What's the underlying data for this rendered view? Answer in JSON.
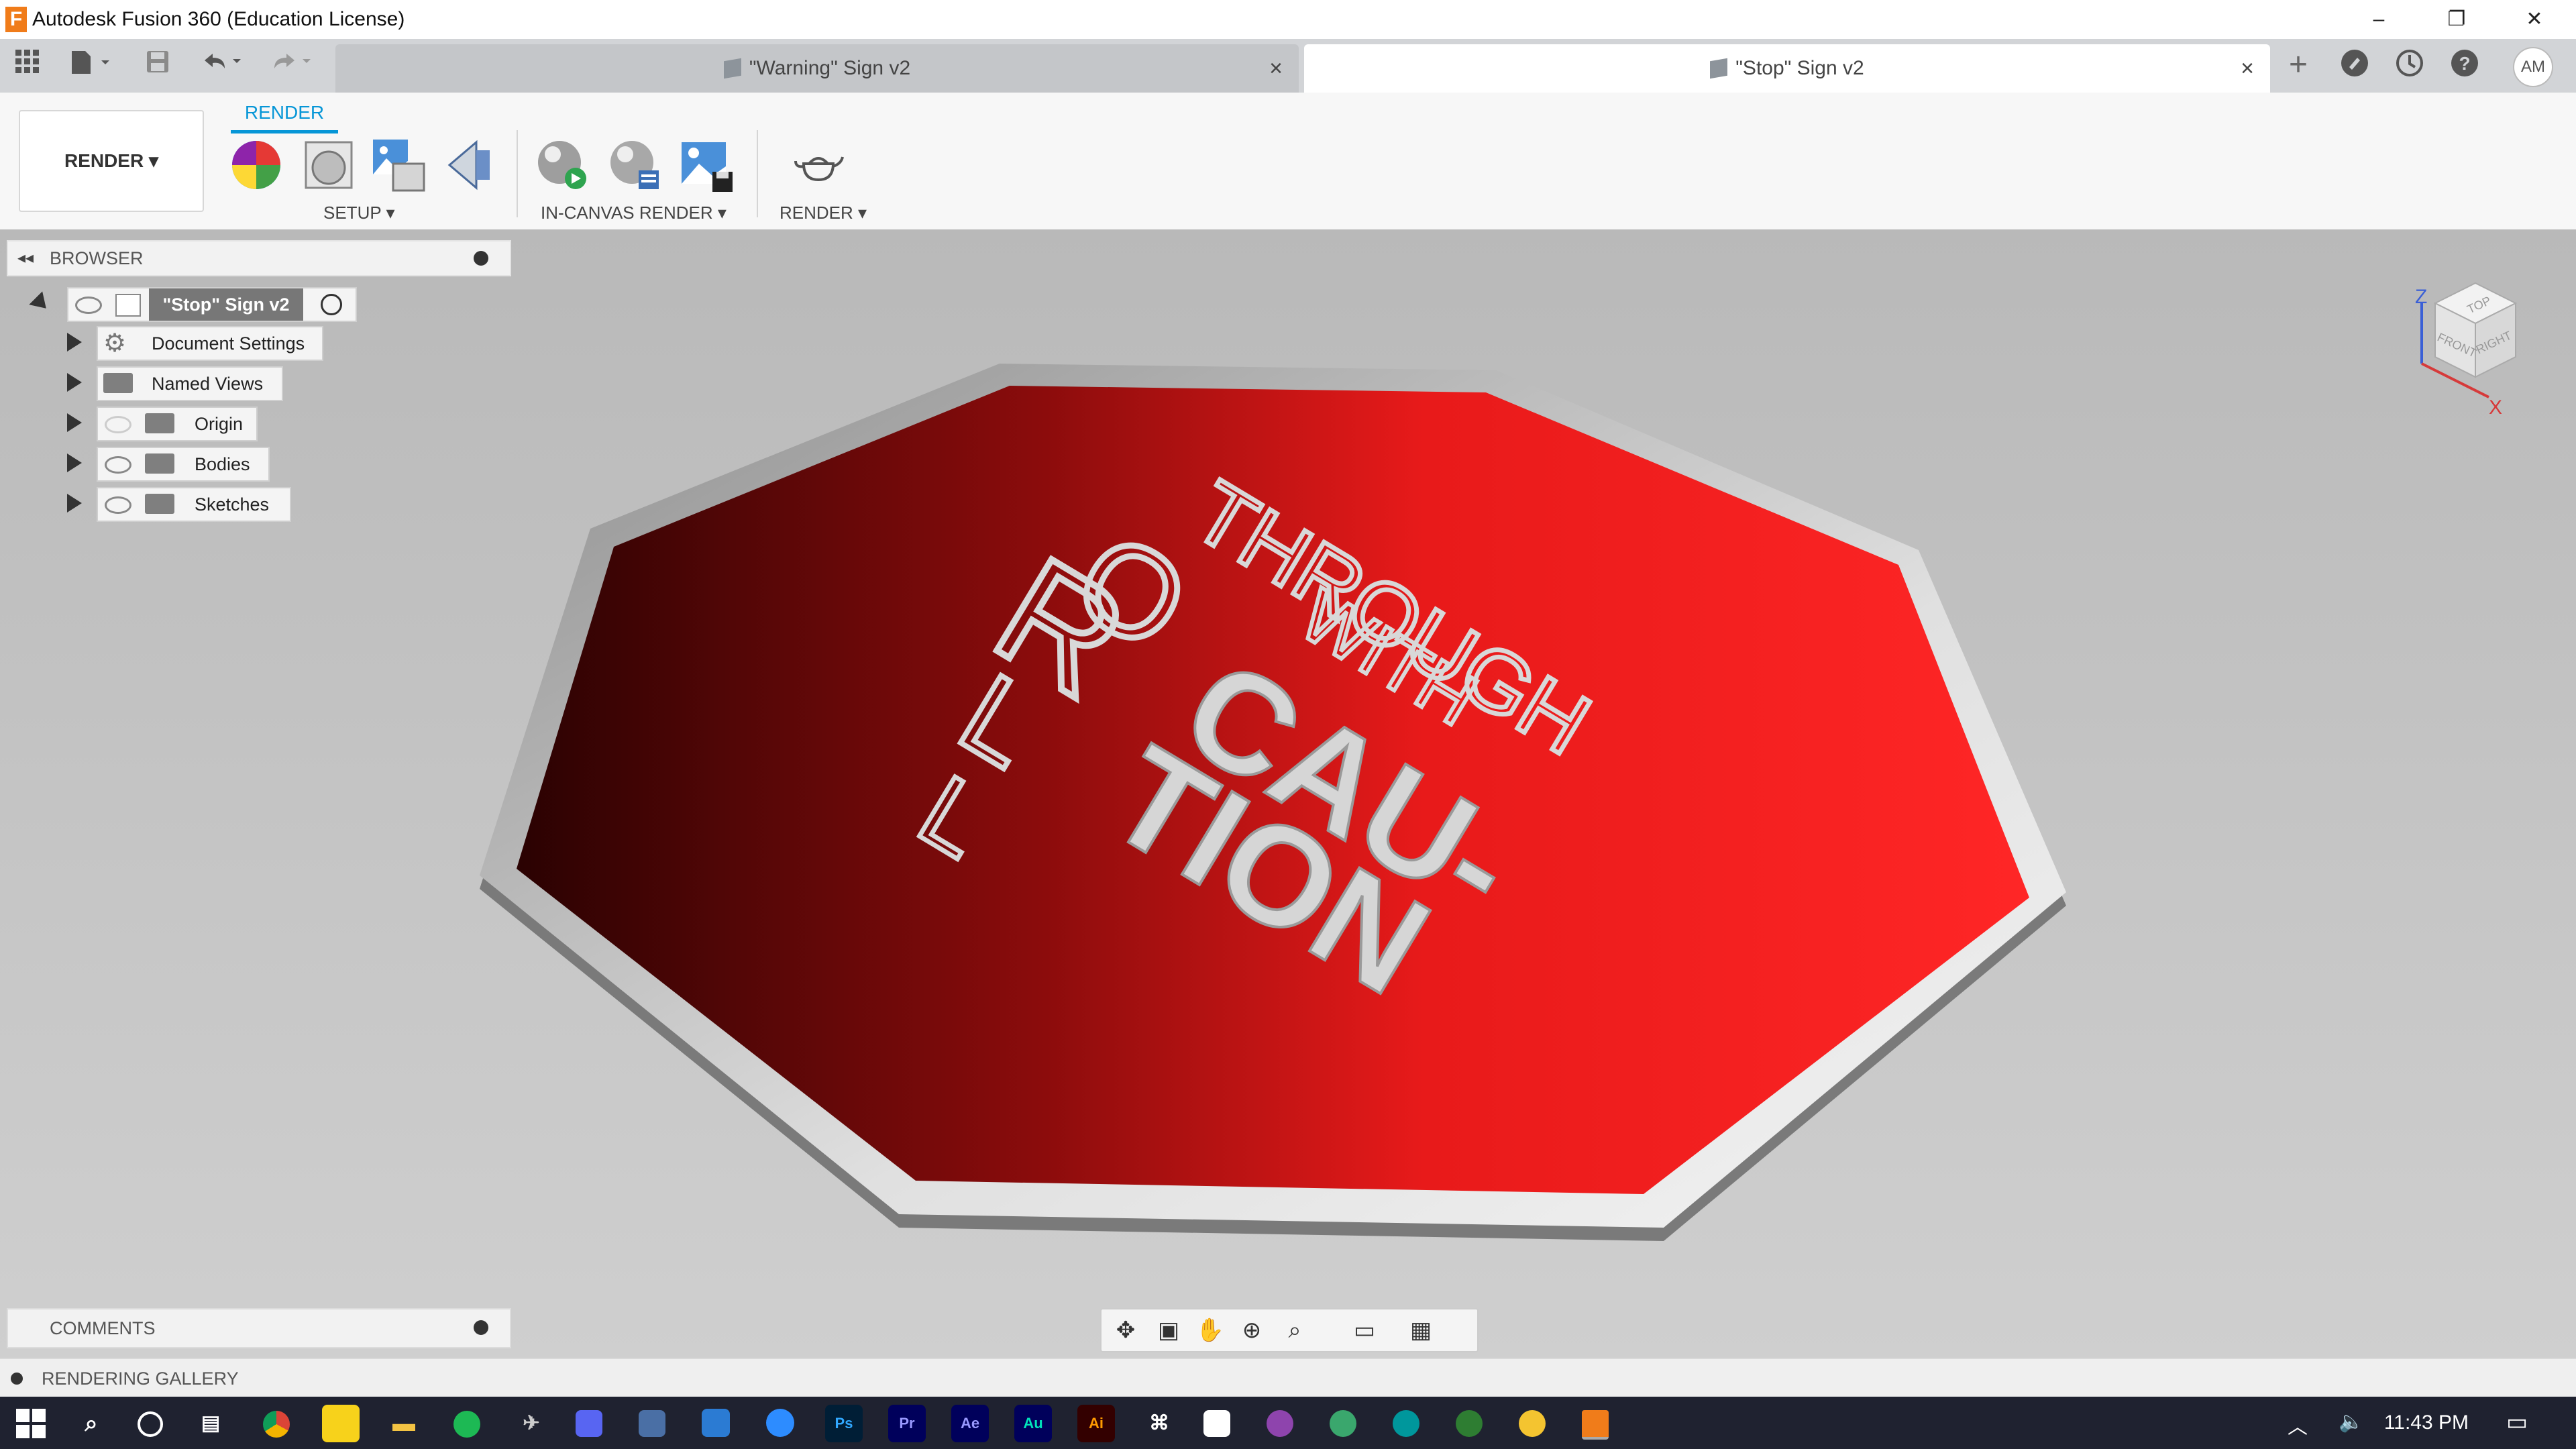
{
  "app": {
    "title": "Autodesk Fusion 360 (Education License)",
    "logo_letter": "F",
    "controls": {
      "minimize": "–",
      "restore": "❐",
      "close": "✕"
    }
  },
  "tabs": [
    {
      "label": "\"Warning\" Sign v2",
      "close": "×",
      "active": false
    },
    {
      "label": "\"Stop\" Sign v2",
      "close": "×",
      "active": true
    }
  ],
  "tabbar_right": {
    "new_tab": "+",
    "avatar": "AM"
  },
  "ribbon": {
    "workspace": "RENDER ▾",
    "active_tab": "RENDER",
    "groups": {
      "setup": "SETUP ▾",
      "in_canvas": "IN-CANVAS RENDER ▾",
      "render": "RENDER ▾"
    }
  },
  "browser": {
    "header": "BROWSER",
    "root": "\"Stop\" Sign v2",
    "items": [
      {
        "label": "Document Settings",
        "icon": "gear-icon"
      },
      {
        "label": "Named Views",
        "icon": "folder-icon"
      },
      {
        "label": "Origin",
        "icon": "folder-icon",
        "hidden": true
      },
      {
        "label": "Bodies",
        "icon": "folder-icon"
      },
      {
        "label": "Sketches",
        "icon": "folder-icon"
      }
    ]
  },
  "sign": {
    "line1": "THROUGH",
    "line2": "WITH",
    "big1": "CAU-",
    "big2": "TION",
    "letter1": "R",
    "letter2": "O",
    "letter3": "L",
    "letter4": "L",
    "colors": {
      "face_dark": "#3a0404",
      "face_mid": "#c41414",
      "face_light": "#ff3030",
      "rim": "#e8e8e8",
      "text": "#d6d6d6"
    }
  },
  "viewcube": {
    "top": "TOP",
    "front": "FRONT",
    "right": "RIGHT",
    "axis_z": "Z",
    "axis_x": "X"
  },
  "bottom": {
    "comments": "COMMENTS",
    "gallery": "RENDERING GALLERY"
  },
  "taskbar": {
    "apps": [
      "Ps",
      "Pr",
      "Ae",
      "Au",
      "Ai"
    ],
    "clock": "11:43 PM"
  }
}
